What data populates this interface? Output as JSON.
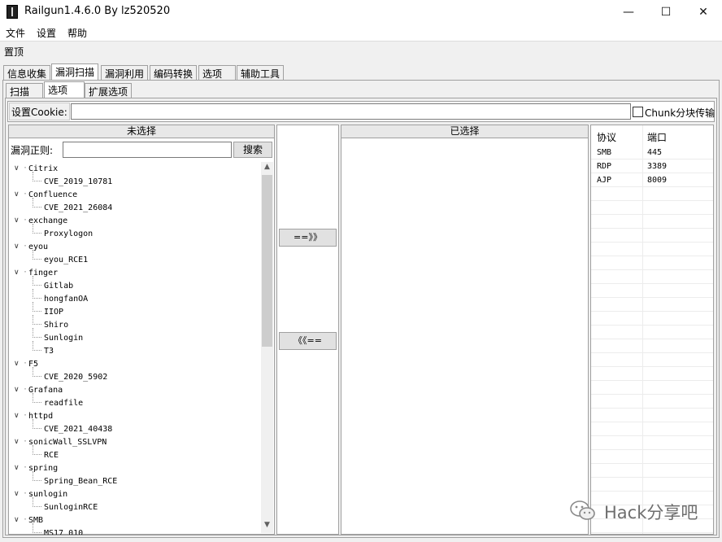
{
  "window": {
    "title": "Railgun1.4.6.0 By lz520520",
    "minimize_glyph": "—",
    "maximize_glyph": "☐",
    "close_glyph": "✕"
  },
  "menu": [
    "文件",
    "设置",
    "帮助"
  ],
  "toolbar": {
    "pin_label": "置顶"
  },
  "main_tabs": [
    "信息收集",
    "漏洞扫描",
    "漏洞利用",
    "编码转换",
    "选项",
    "辅助工具"
  ],
  "sub_tabs": [
    "扫描",
    "选项",
    "扩展选项"
  ],
  "cookie": {
    "label": "设置Cookie:",
    "value": "",
    "chunk_label": "Chunk分块传输"
  },
  "left": {
    "header": "未选择",
    "regex_label": "漏洞正则:",
    "regex_value": "",
    "search_label": "搜索",
    "tree": [
      {
        "name": "Citrix",
        "children": [
          "CVE_2019_10781"
        ]
      },
      {
        "name": "Confluence",
        "children": [
          "CVE_2021_26084"
        ]
      },
      {
        "name": "exchange",
        "children": [
          "Proxylogon"
        ]
      },
      {
        "name": "eyou",
        "children": [
          "eyou_RCE1"
        ]
      },
      {
        "name": "finger",
        "children": [
          "Gitlab",
          "hongfanOA",
          "IIOP",
          "Shiro",
          "Sunlogin",
          "T3"
        ]
      },
      {
        "name": "F5",
        "children": [
          "CVE_2020_5902"
        ]
      },
      {
        "name": "Grafana",
        "children": [
          "readfile"
        ]
      },
      {
        "name": "httpd",
        "children": [
          "CVE_2021_40438"
        ]
      },
      {
        "name": "sonicWall_SSLVPN",
        "children": [
          "RCE"
        ]
      },
      {
        "name": "spring",
        "children": [
          "Spring_Bean_RCE"
        ]
      },
      {
        "name": "sunlogin",
        "children": [
          "SunloginRCE"
        ]
      },
      {
        "name": "SMB",
        "children": [
          "MS17_010"
        ]
      }
    ]
  },
  "middle": {
    "add_label": "==》》",
    "remove_label": "《《=="
  },
  "right": {
    "header": "已选择"
  },
  "ports": {
    "headers": [
      "协议",
      "端口"
    ],
    "rows": [
      [
        "SMB",
        "445"
      ],
      [
        "RDP",
        "3389"
      ],
      [
        "AJP",
        "8009"
      ]
    ]
  },
  "watermark": "Hack分享吧"
}
